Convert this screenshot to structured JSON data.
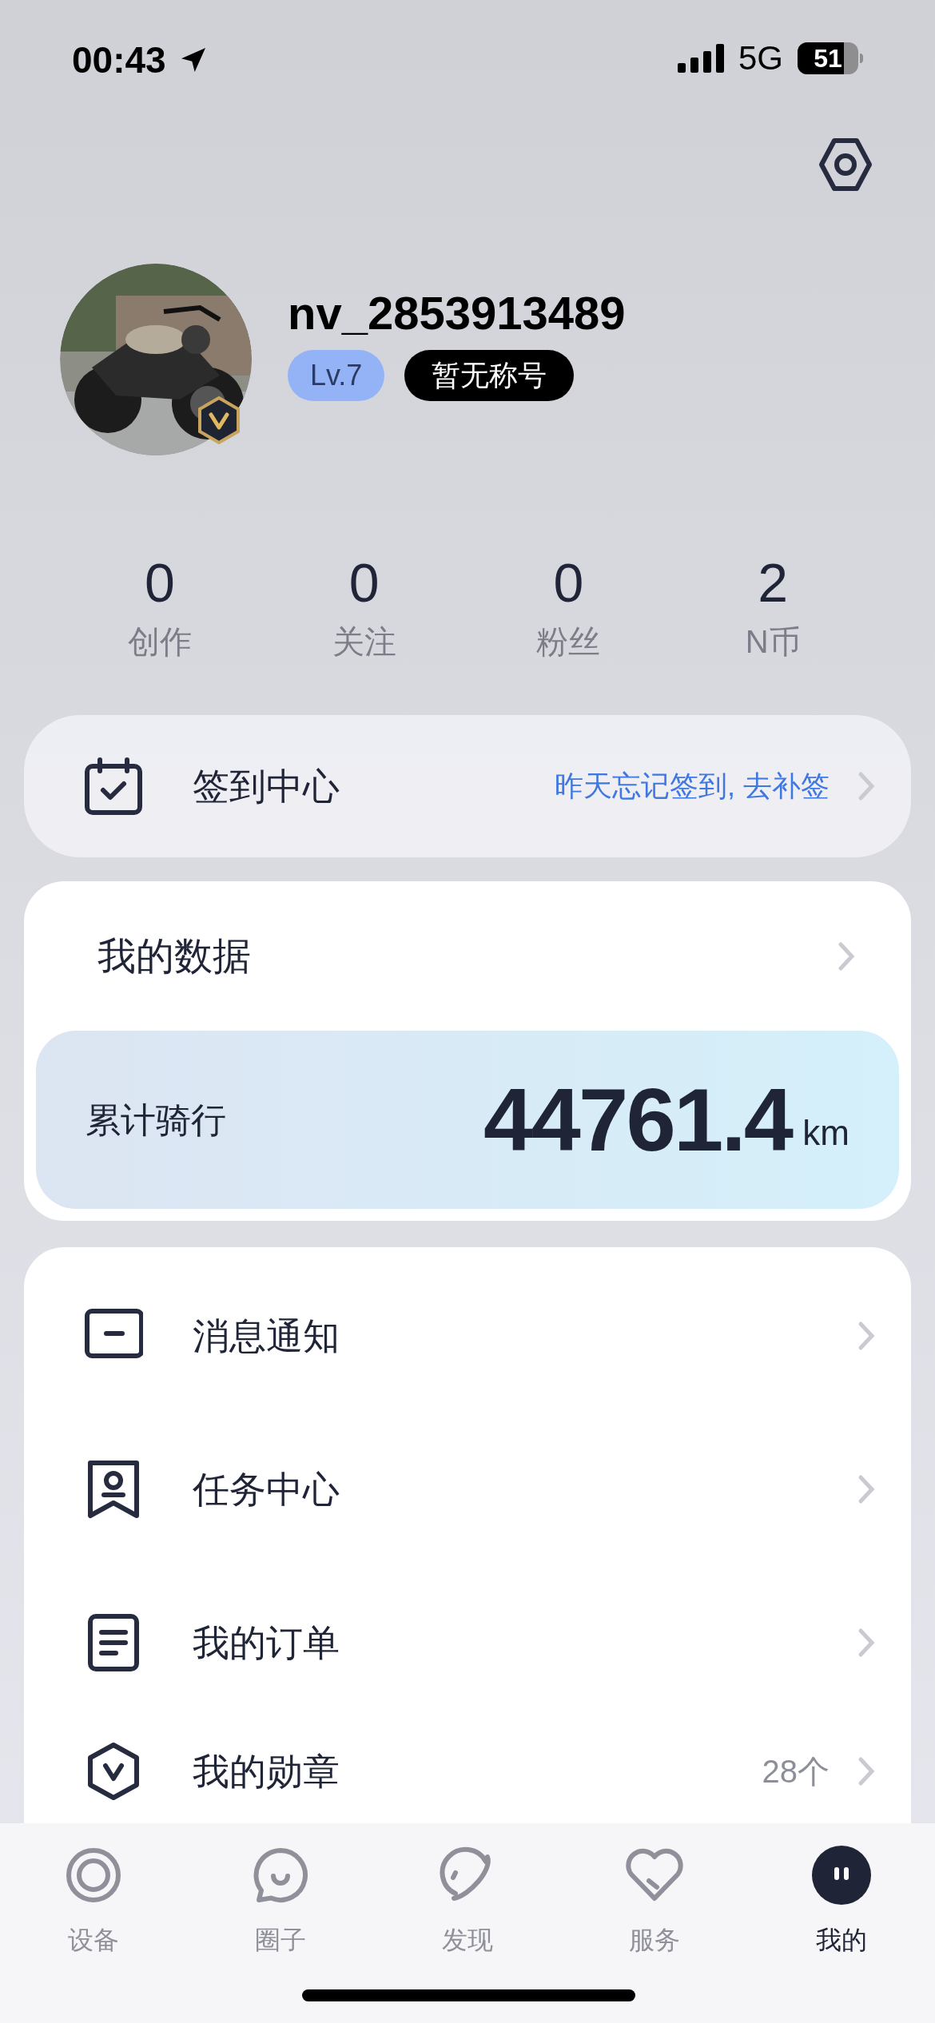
{
  "status_bar": {
    "time": "00:43",
    "network": "5G",
    "battery": "51"
  },
  "profile": {
    "username": "nv_2853913489",
    "level": "Lv.7",
    "title": "暂无称号"
  },
  "stats": [
    {
      "value": "0",
      "label": "创作"
    },
    {
      "value": "0",
      "label": "关注"
    },
    {
      "value": "0",
      "label": "粉丝"
    },
    {
      "value": "2",
      "label": "N币"
    }
  ],
  "checkin": {
    "label": "签到中心",
    "hint": "昨天忘记签到, 去补签"
  },
  "my_data": {
    "title": "我的数据",
    "total_label": "累计骑行",
    "total_value": "44761.4",
    "unit": "km"
  },
  "menu": [
    {
      "label": "消息通知"
    },
    {
      "label": "任务中心"
    },
    {
      "label": "我的订单"
    },
    {
      "label": "我的勋章",
      "count": "28个"
    }
  ],
  "tabs": [
    {
      "label": "设备",
      "selected": false
    },
    {
      "label": "圈子",
      "selected": false
    },
    {
      "label": "发现",
      "selected": false
    },
    {
      "label": "服务",
      "selected": false
    },
    {
      "label": "我的",
      "selected": true
    }
  ]
}
